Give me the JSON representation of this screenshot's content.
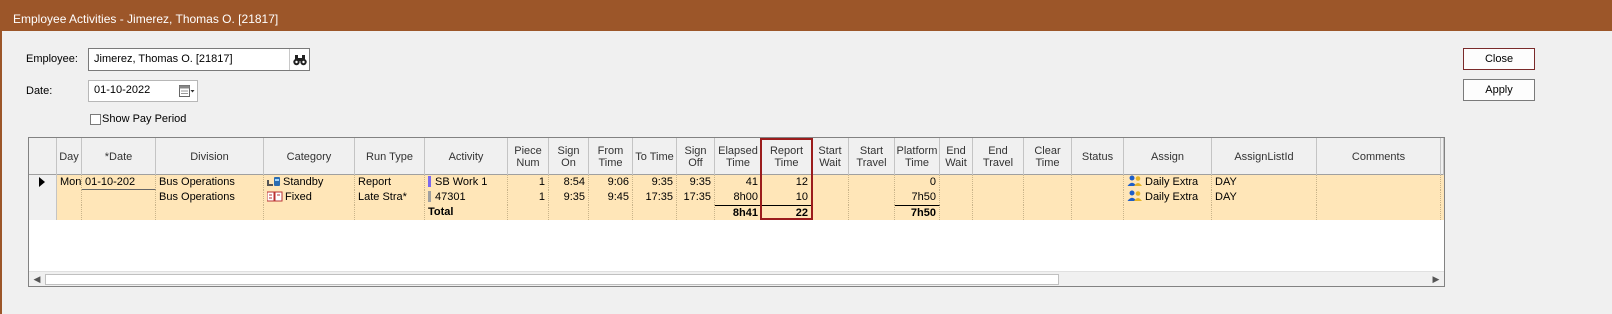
{
  "window": {
    "title": "Employee Activities - Jimerez, Thomas O.  [21817]"
  },
  "form": {
    "employee_label": "Employee:",
    "employee_value": "Jimerez, Thomas O.  [21817]",
    "date_label": "Date:",
    "date_value": "01-10-2022",
    "show_pay_period_label": "Show Pay Period",
    "show_pay_period_checked": false
  },
  "buttons": {
    "close": "Close",
    "apply": "Apply"
  },
  "grid": {
    "headers": [
      "Day",
      "*Date",
      "Division",
      "Category",
      "Run Type",
      "Activity",
      "Piece Num",
      "Sign On",
      "From Time",
      "To Time",
      "Sign Off",
      "Elapsed Time",
      "Report Time",
      "Start Wait",
      "Start Travel",
      "Platform Time",
      "End Wait",
      "End Travel",
      "Clear Time",
      "Status",
      "Assign",
      "AssignListId",
      "Comments"
    ],
    "rows": [
      {
        "day": "Mon",
        "date": "01-10-202",
        "division": "Bus Operations",
        "category": "Standby",
        "run_type": "Report",
        "activity": "SB Work 1",
        "piece_num": "1",
        "sign_on": "8:54",
        "from_time": "9:06",
        "to_time": "9:35",
        "sign_off": "9:35",
        "elapsed_time": "41",
        "report_time": "12",
        "start_wait": "",
        "start_travel": "",
        "platform_time": "0",
        "end_wait": "",
        "end_travel": "",
        "clear_time": "",
        "status": "",
        "assign": "Daily Extra",
        "assign_list_id": "DAY",
        "comments": ""
      },
      {
        "day": "",
        "date": "",
        "division": "Bus Operations",
        "category": "Fixed",
        "run_type": "Late Stra*",
        "activity": "47301",
        "piece_num": "1",
        "sign_on": "9:35",
        "from_time": "9:45",
        "to_time": "17:35",
        "sign_off": "17:35",
        "elapsed_time": "8h00",
        "report_time": "10",
        "start_wait": "",
        "start_travel": "",
        "platform_time": "7h50",
        "end_wait": "",
        "end_travel": "",
        "clear_time": "",
        "status": "",
        "assign": "Daily Extra",
        "assign_list_id": "DAY",
        "comments": ""
      }
    ],
    "total": {
      "label": "Total",
      "elapsed_time": "8h41",
      "report_time": "22",
      "platform_time": "7h50"
    }
  },
  "colors": {
    "title_bar": "#9c5629",
    "row_bg": "#ffe6b8",
    "highlight_border": "#9b1c1c",
    "activity_bar_1": "#7b68ee",
    "activity_bar_2": "#a0a0a0"
  },
  "icons": {
    "employee_lookup": "binoculars-icon",
    "date_picker": "calendar-icon",
    "standby": "standby-icon",
    "fixed": "fixed-schedule-icon",
    "assign": "users-icon",
    "current_row": "row-pointer-icon"
  }
}
